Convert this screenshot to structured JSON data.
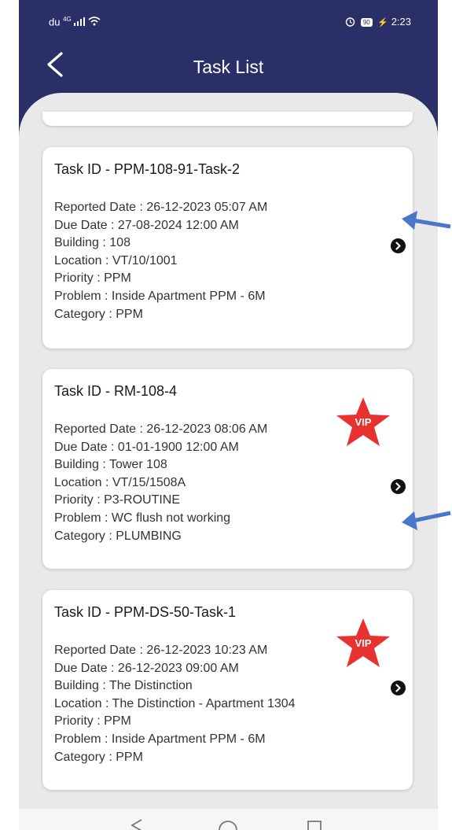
{
  "status_bar": {
    "carrier": "du",
    "signal": "4G",
    "time": "2:23",
    "battery": "90"
  },
  "header": {
    "title": "Task List"
  },
  "tasks": [
    {
      "id": "Task ID - PPM-108-91-Task-2",
      "vip": false,
      "fields": [
        "Reported Date :  26-12-2023  05:07 AM",
        "Due Date :  27-08-2024  12:00 AM",
        "Building :  108",
        "Location :  VT/10/1001",
        "Priority :  PPM",
        "Problem :  Inside Apartment PPM - 6M",
        "Category :  PPM"
      ]
    },
    {
      "id": "Task ID - RM-108-4",
      "vip": true,
      "vip_label": "VIP",
      "fields": [
        "Reported Date :  26-12-2023  08:06 AM",
        "Due Date :  01-01-1900  12:00 AM",
        "Building :  Tower 108",
        "Location :  VT/15/1508A",
        "Priority :  P3-ROUTINE",
        "Problem :  WC flush not working",
        "Category :  PLUMBING"
      ]
    },
    {
      "id": "Task ID - PPM-DS-50-Task-1",
      "vip": true,
      "vip_label": "VIP",
      "fields": [
        "Reported Date :  26-12-2023  10:23 AM",
        "Due Date :  26-12-2023  09:00 AM",
        "Building :  The Distinction",
        "Location :  The Distinction - Apartment 1304",
        "Priority :  PPM",
        "Problem :  Inside Apartment PPM - 6M",
        "Category :  PPM"
      ]
    }
  ],
  "colors": {
    "header_bg": "#2b2f68",
    "list_bg": "#e9e9e9",
    "card_bg": "#ffffff",
    "vip_badge": "#e8322f",
    "annotation_arrow": "#4a77c9"
  },
  "icons": {
    "back": "chevron-left-icon",
    "open_task": "chevron-right-circle-icon",
    "vip": "star-badge-icon",
    "nav_back": "triangle-back-icon",
    "nav_home": "circle-home-icon",
    "nav_recents": "square-recents-icon"
  }
}
